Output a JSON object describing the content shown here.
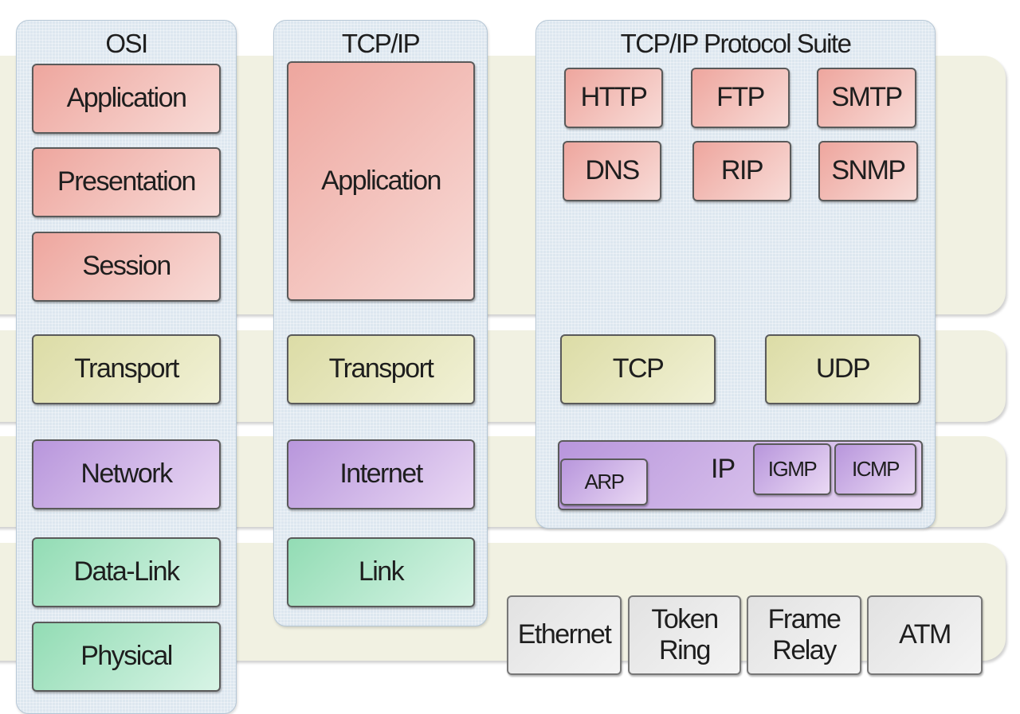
{
  "colors": {
    "application": "#eea69e",
    "transport": "#dcdca6",
    "network": "#b896dc",
    "link": "#92dcb4",
    "physical_protocols": "#e8e8e8",
    "column": "#dde7ef",
    "band": "#f1f1e2"
  },
  "osi": {
    "title": "OSI",
    "layers": [
      "Application",
      "Presentation",
      "Session",
      "Transport",
      "Network",
      "Data-Link",
      "Physical"
    ]
  },
  "tcpip": {
    "title": "TCP/IP",
    "layers": [
      "Application",
      "Transport",
      "Internet",
      "Link"
    ]
  },
  "suite": {
    "title": "TCP/IP Protocol Suite",
    "application": [
      "HTTP",
      "FTP",
      "SMTP",
      "DNS",
      "RIP",
      "SNMP"
    ],
    "transport": [
      "TCP",
      "UDP"
    ],
    "internet": {
      "label": "IP",
      "protocols": [
        "ARP",
        "IGMP",
        "ICMP"
      ]
    },
    "link": [
      "Ethernet",
      "Token Ring",
      "Frame Relay",
      "ATM"
    ]
  }
}
